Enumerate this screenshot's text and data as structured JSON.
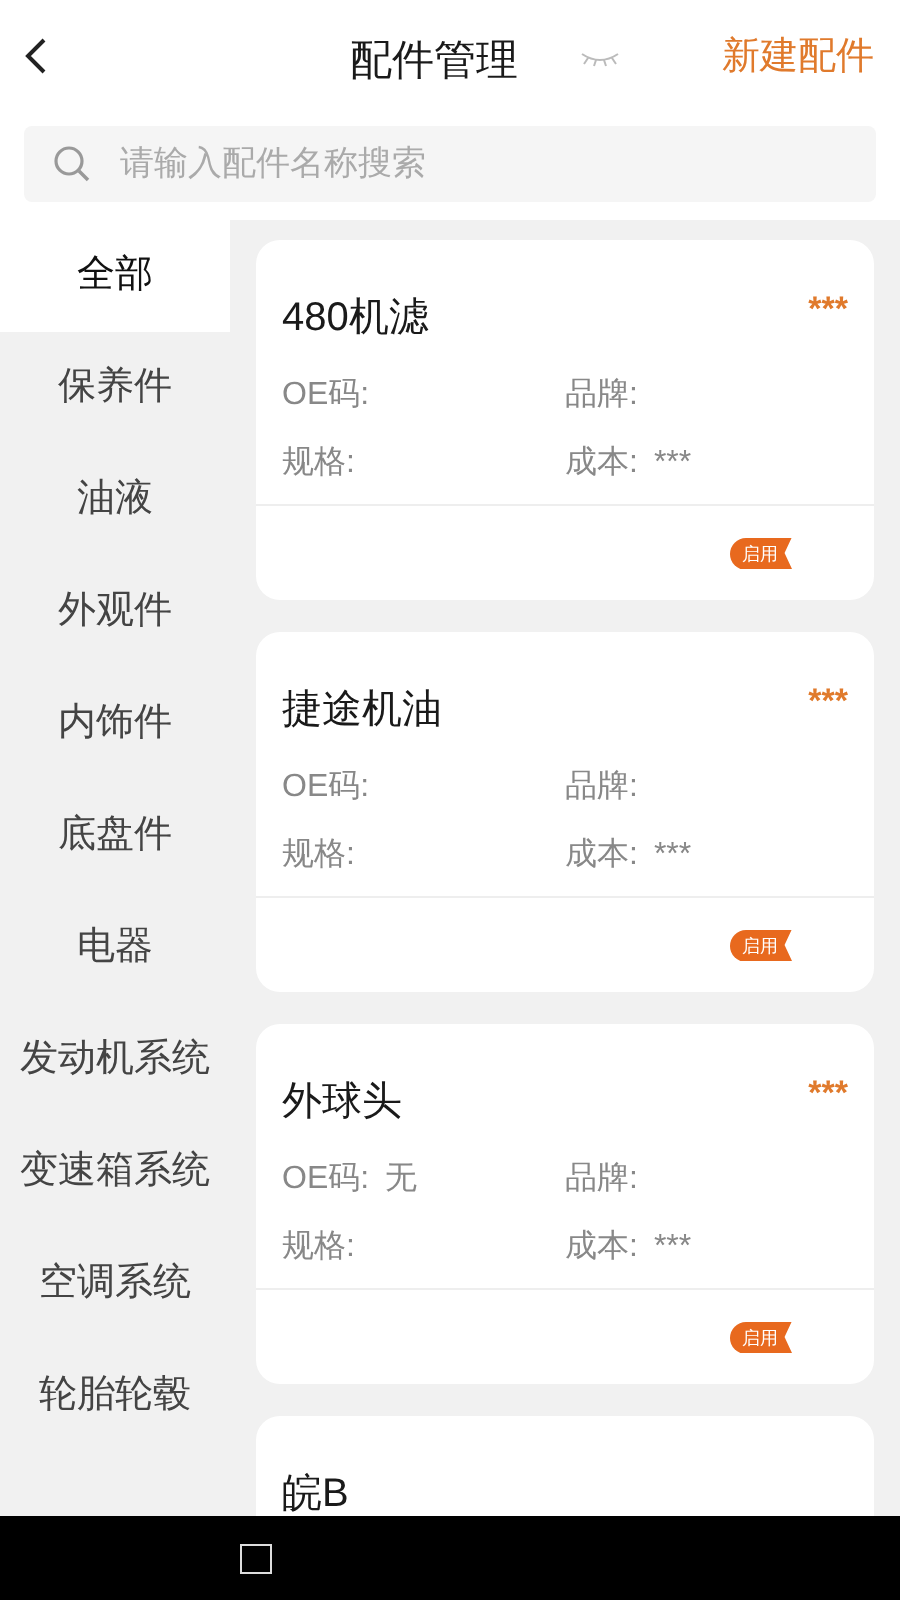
{
  "header": {
    "title": "配件管理",
    "action": "新建配件"
  },
  "search": {
    "placeholder": "请输入配件名称搜索"
  },
  "categories": [
    {
      "label": "全部",
      "selected": true
    },
    {
      "label": "保养件",
      "selected": false
    },
    {
      "label": "油液",
      "selected": false
    },
    {
      "label": "外观件",
      "selected": false
    },
    {
      "label": "内饰件",
      "selected": false
    },
    {
      "label": "底盘件",
      "selected": false
    },
    {
      "label": "电器",
      "selected": false
    },
    {
      "label": "发动机系统",
      "selected": false
    },
    {
      "label": "变速箱系统",
      "selected": false
    },
    {
      "label": "空调系统",
      "selected": false
    },
    {
      "label": "轮胎轮毂",
      "selected": false
    }
  ],
  "parts": [
    {
      "name": "480机滤",
      "price": "***",
      "oe_label": "OE码:",
      "brand_label": "品牌:",
      "spec_label": "规格:",
      "cost_label": "成本:",
      "cost_value": "***",
      "status": "启用"
    },
    {
      "name": "捷途机油",
      "price": "***",
      "oe_label": "OE码:",
      "brand_label": "品牌:",
      "spec_label": "规格:",
      "cost_label": "成本:",
      "cost_value": "***",
      "status": "启用"
    },
    {
      "name": "外球头",
      "price": "***",
      "oe_label": "OE码:",
      "oe_value": "无",
      "brand_label": "品牌:",
      "spec_label": "规格:",
      "cost_label": "成本:",
      "cost_value": "***",
      "status": "启用"
    },
    {
      "name": "皖B"
    }
  ]
}
